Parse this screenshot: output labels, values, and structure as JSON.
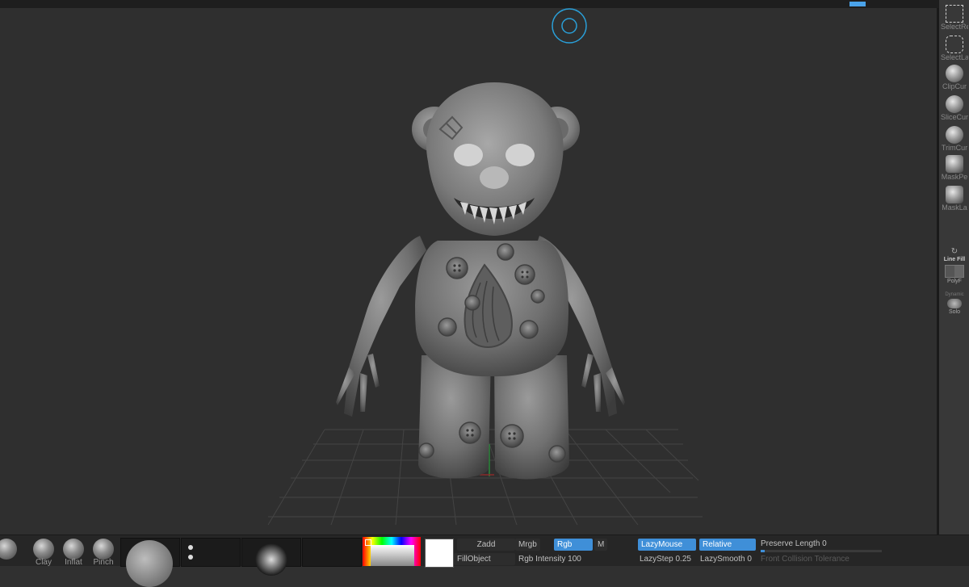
{
  "bottom": {
    "brushes": [
      {
        "label": ""
      },
      {
        "label": "Clay"
      },
      {
        "label": "Inflat"
      },
      {
        "label": "Pinch"
      }
    ],
    "zadd": "Zadd",
    "mrgb": "Mrgb",
    "rgb": "Rgb",
    "m": "M",
    "fill_object": "FillObject",
    "rgb_intensity": {
      "label": "Rgb Intensity",
      "value": "100"
    },
    "lazy_mouse": "LazyMouse",
    "relative": "Relative",
    "lazy_step": {
      "label": "LazyStep",
      "value": "0.25"
    },
    "lazy_smooth": {
      "label": "LazySmooth",
      "value": "0"
    },
    "preserve_length": {
      "label": "Preserve Length",
      "value": "0",
      "fill": 0.03
    },
    "front_collision": {
      "label": "Front Collision Tolerance"
    }
  },
  "right_shelf": [
    {
      "label": "SelectRe",
      "icon": "select-rect-icon"
    },
    {
      "label": "SelectLa",
      "icon": "select-lasso-icon"
    },
    {
      "label": "ClipCur",
      "icon": "clip-curve-icon"
    },
    {
      "label": "SliceCur",
      "icon": "slice-curve-icon"
    },
    {
      "label": "TrimCur",
      "icon": "trim-curve-icon"
    },
    {
      "label": "MaskPe",
      "icon": "mask-pen-icon"
    },
    {
      "label": "MaskLa",
      "icon": "mask-lasso-icon"
    }
  ],
  "right_tools": {
    "line_fill": "Line Fill",
    "polyf": "PolyF",
    "dynamic": "Dynamic",
    "solo": "Solo"
  },
  "colors": {
    "accent": "#3f8fd8",
    "viewport": "#2f2f2f",
    "gizmo": "#2a9fd8"
  }
}
